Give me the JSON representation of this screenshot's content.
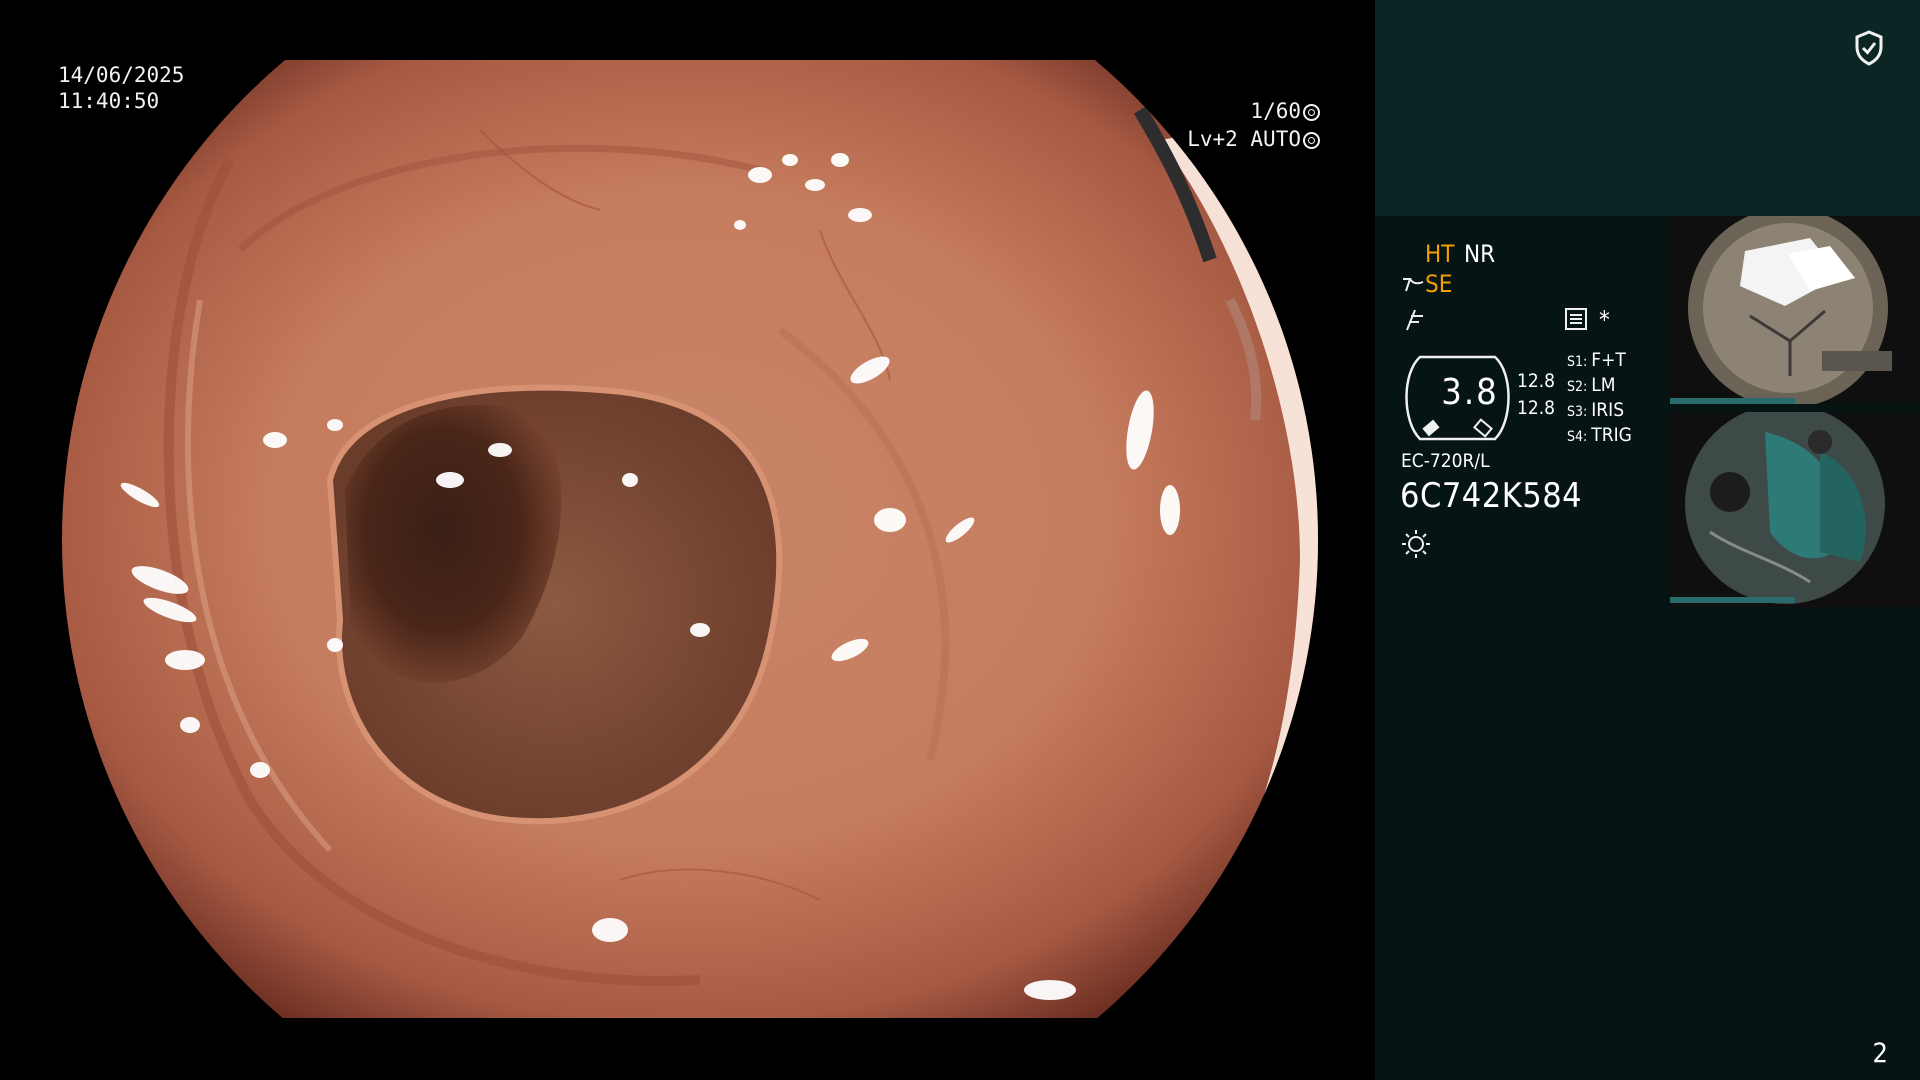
{
  "overlay": {
    "date": "14/06/2025",
    "time": "11:40:50",
    "shutter": "1/60",
    "agc": "Lv+2 AUTO"
  },
  "panel": {
    "ht": "HT",
    "nr": "NR",
    "se": "SE",
    "star": "*",
    "zoom": "3.8",
    "value_a": "12.8",
    "value_b": "12.8",
    "switches": [
      {
        "key": "S1:",
        "value": "F+T"
      },
      {
        "key": "S2:",
        "value": "LM"
      },
      {
        "key": "S3:",
        "value": "IRIS"
      },
      {
        "key": "S4:",
        "value": "TRIG"
      }
    ],
    "scope_model": "EC-720R/L",
    "scope_serial": "6C742K584",
    "page_number": "2"
  },
  "colors": {
    "accent_orange": "#f2a000",
    "top_panel": "#0b2424",
    "side_panel": "#061414"
  },
  "icons": [
    "shield-check-icon",
    "shutter-icon",
    "iris-icon",
    "se-icon",
    "freeze-icon",
    "enhance-bars-icon",
    "zoom-gauge-icon",
    "light-icon"
  ]
}
